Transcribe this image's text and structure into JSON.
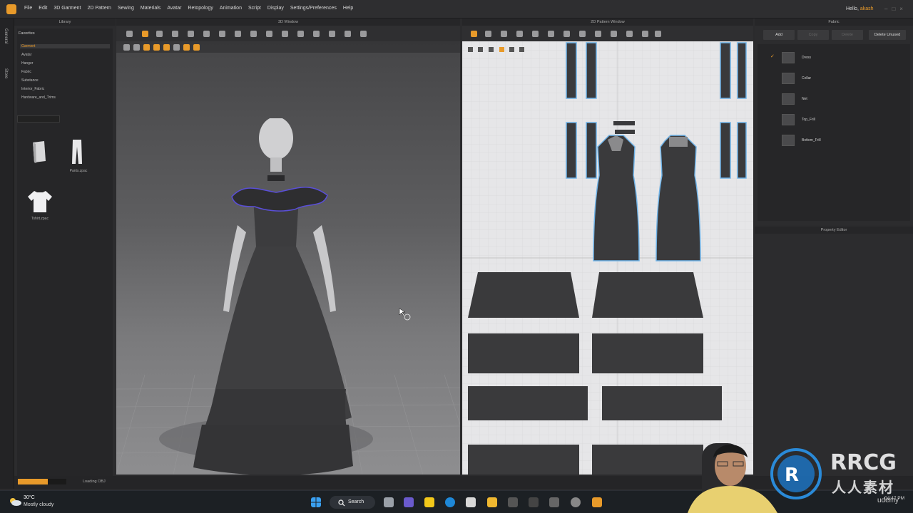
{
  "menubar": {
    "items": [
      "File",
      "Edit",
      "3D Garment",
      "2D Pattern",
      "Sewing",
      "Materials",
      "Avatar",
      "Retopology",
      "Animation",
      "Script",
      "Display",
      "Settings/Preferences",
      "Help"
    ],
    "greeting": "Hello,",
    "username": "akash"
  },
  "sidetabs": [
    "General",
    "Store"
  ],
  "library": {
    "header": "Library",
    "favorites_title": "Favorites",
    "favorites": [
      "Garment",
      "Avatar",
      "Hanger",
      "Fabric",
      "Substance",
      "Interior_Fabric",
      "Hardware_and_Trims"
    ],
    "selected": "Garment",
    "files": [
      "Pants.zpac",
      "Tshirt.zpac"
    ]
  },
  "window3d": {
    "header": "3D Window"
  },
  "window2d": {
    "header": "2D Pattern Window"
  },
  "fabric": {
    "header": "Fabric",
    "buttons": [
      "Add",
      "Copy",
      "Delete",
      "Delete Unused"
    ],
    "items": [
      "Dress",
      "Collar",
      "Net",
      "Top_Frill",
      "Bottom_Frill"
    ],
    "checked": "Dress"
  },
  "property_editor": {
    "header": "Property Editor"
  },
  "status": {
    "progress": 0.62,
    "text": "Loading OBJ"
  },
  "taskbar": {
    "temperature": "30°C",
    "weather": "Mostly cloudy",
    "search": "Search",
    "time": "04:47 PM"
  },
  "watermark": {
    "brand": "RRCG",
    "chinese": "人人素材",
    "platform": "udemy"
  },
  "colors": {
    "accent": "#e89a2a",
    "pattern_outline": "#6fb3e8",
    "garment": "#3a3a3c"
  }
}
